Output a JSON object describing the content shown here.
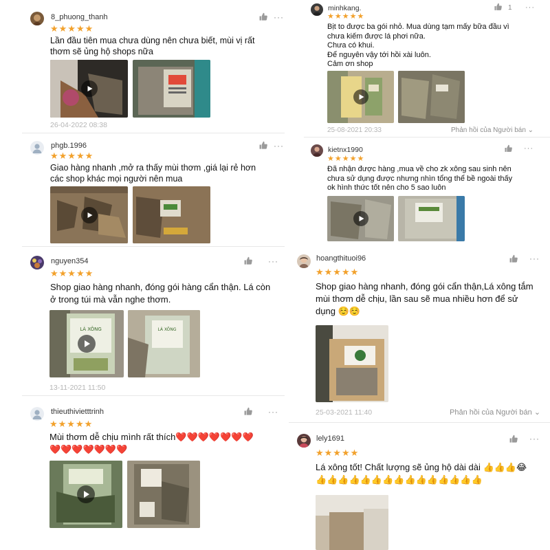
{
  "colors": {
    "star": "#f2a12c",
    "text": "#111111",
    "muted": "#b5b5b5",
    "heart": "#e0181e"
  },
  "reviews": [
    {
      "username": "8_phuong_thanh",
      "stars": "★★★★★",
      "text": "Lần đầu tiên mua chưa dùng nên chưa biết, mùi vị rất\nthơm sẽ ủng hộ shops nữa",
      "date": "26-04-2022 08:38",
      "more": "···"
    },
    {
      "username": "phgb.1996",
      "stars": "★★★★★",
      "text": "Giao hàng nhanh ,mở ra thấy mùi thơm ,giá lại rẻ hơn\ncác shop khác mọi người nên mua",
      "more": "···"
    },
    {
      "username": "nguyen354",
      "stars": "★★★★★",
      "text": "Shop giao hàng nhanh, đóng gói hàng cẩn thận. Lá còn\nở trong túi mà vẫn nghe thơm.",
      "date": "13-11-2021 11:50",
      "more": "···"
    },
    {
      "username": "thieuthivietttrinh",
      "stars": "★★★★★",
      "text": "Mùi thơm dễ chịu mình rất thích❤️❤️❤️❤️❤️❤️❤️\n❤️❤️❤️❤️❤️❤️❤️",
      "more": "···"
    },
    {
      "username": "minhkang.",
      "stars": "★★★★★",
      "like_count": "1",
      "text": "Bịt to được ba gói nhỏ. Mua dùng tạm mấy bữa đầu vì\nchưa kiếm được lá phơi nữa.\nChưa có khui.\nĐể nguyên vậy tới hồi xài luôn.\nCảm ơn shop",
      "date": "25-08-2021 20:33",
      "reply": "Phản hồi của Người bán ⌄",
      "more": "···"
    },
    {
      "username": "kietnx1990",
      "stars": "★★★★★",
      "text": "Đã nhận được hàng ,mua về cho zk xông sau sinh nên\nchưa sử dụng được nhưng nhìn tổng thể bề ngoài thấy\nok hình thức tốt nên cho 5 sao luôn",
      "more": "···"
    },
    {
      "username": "hoangthituoi96",
      "stars": "★★★★★",
      "text": "Shop giao hàng nhanh, đóng gói cẩn thận,Lá xông tắm\nmùi thơm dễ chịu, lần sau sẽ mua nhiều hơn để sử\ndụng ☺️☺️",
      "date": "25-03-2021 11:40",
      "reply": "Phản hồi của Người bán ⌄",
      "more": "···"
    },
    {
      "username": "lely1691",
      "stars": "★★★★★",
      "text": "Lá xông tốt! Chất lượng sẽ ủng hộ dài dài 👍👍👍😂\n👍👍👍👍👍👍👍👍👍👍👍👍👍👍👍",
      "more": "···"
    }
  ]
}
